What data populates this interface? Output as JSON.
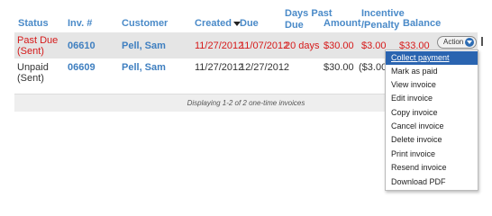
{
  "headers": {
    "status": "Status",
    "invoice": "Inv. #",
    "customer": "Customer",
    "created": "Created",
    "due": "Due",
    "days_past_due_1": "Days Past",
    "days_past_due_2": "Due",
    "amount": "Amount",
    "incentive_1": "Incentive",
    "incentive_2": "/Penalty",
    "balance": "Balance"
  },
  "rows": [
    {
      "status_1": "Past Due",
      "status_2": "(Sent)",
      "invoice": "06610",
      "customer": "Pell, Sam",
      "created": "11/27/2012",
      "due": "11/07/2012",
      "days_past_due": "20 days",
      "amount": "$30.00",
      "incentive": "$3.00",
      "balance": "$33.00"
    },
    {
      "status_1": "Unpaid",
      "status_2": "(Sent)",
      "invoice": "06609",
      "customer": "Pell, Sam",
      "created": "11/27/2012",
      "due": "12/27/2012",
      "days_past_due": "",
      "amount": "$30.00",
      "incentive": "($3.00)",
      "balance": ""
    }
  ],
  "footer": "Displaying 1-2 of 2 one-time invoices",
  "action_button": "Action",
  "menu": [
    "Collect payment",
    "Mark as paid",
    "View invoice",
    "Edit invoice",
    "Copy invoice",
    "Cancel invoice",
    "Delete invoice",
    "Print invoice",
    "Resend invoice",
    "Download PDF"
  ],
  "colors": {
    "header_text": "#4a8ac8",
    "overdue_text": "#d61a1a",
    "row_highlight": "#e5e5e5",
    "menu_active": "#2a64b0"
  }
}
